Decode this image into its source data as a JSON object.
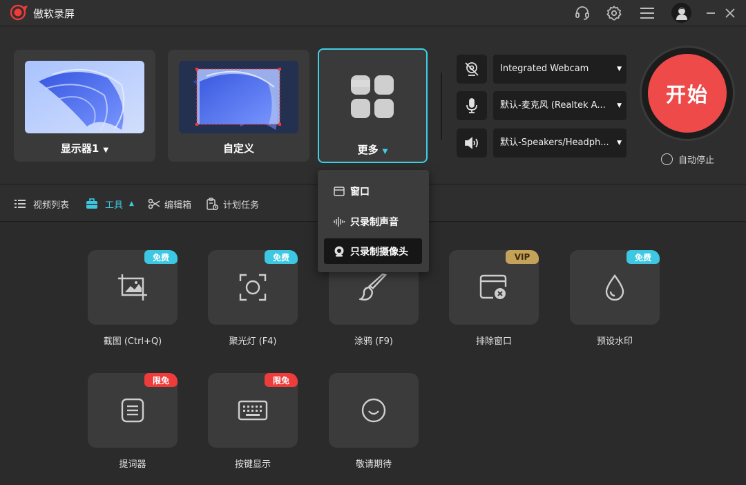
{
  "app": {
    "title": "傲软录屏"
  },
  "sources": [
    {
      "label": "显示器1"
    },
    {
      "label": "自定义"
    },
    {
      "label": "更多"
    }
  ],
  "devices": {
    "webcam": "Integrated Webcam",
    "microphone": "默认-麦克风 (Realtek A...",
    "speaker": "默认-Speakers/Headph..."
  },
  "start": {
    "label": "开始"
  },
  "auto_stop": {
    "label": "自动停止"
  },
  "tabs": [
    {
      "label": "视频列表"
    },
    {
      "label": "工具"
    },
    {
      "label": "编辑箱"
    },
    {
      "label": "计划任务"
    }
  ],
  "dropdown": [
    {
      "label": "窗口"
    },
    {
      "label": "只录制声音"
    },
    {
      "label": "只录制摄像头"
    }
  ],
  "tools": [
    {
      "label": "截图 (Ctrl+Q)",
      "badge": "免费"
    },
    {
      "label": "聚光灯 (F4)",
      "badge": "免费"
    },
    {
      "label": "涂鸦 (F9)",
      "badge": ""
    },
    {
      "label": "排除窗口",
      "badge": "VIP"
    },
    {
      "label": "预设水印",
      "badge": "免费"
    },
    {
      "label": "提词器",
      "badge": "限免"
    },
    {
      "label": "按键显示",
      "badge": "限免"
    },
    {
      "label": "敬请期待",
      "badge": ""
    }
  ],
  "colors": {
    "accent": "#3ec8e0",
    "start": "#ef4a4a",
    "free_badge": "#3cc7e2",
    "limit_badge": "#ee3b3b",
    "vip_badge": "#c5a259"
  }
}
